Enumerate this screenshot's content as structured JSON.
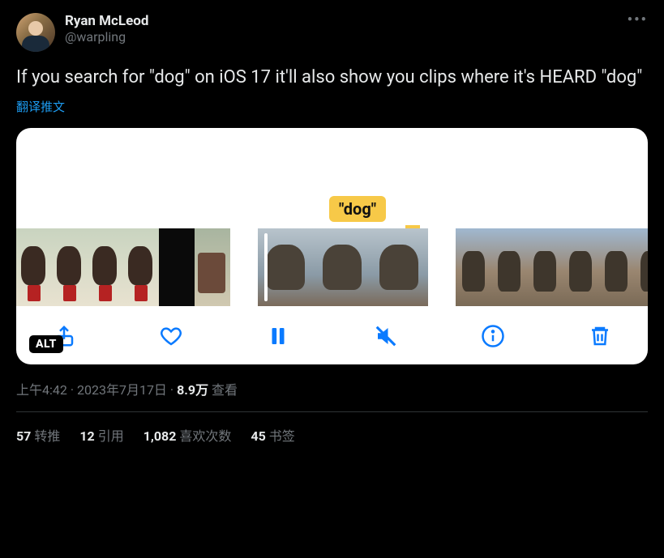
{
  "author": {
    "display_name": "Ryan McLeod",
    "handle": "@warpling"
  },
  "more_glyph": "•••",
  "body_text": "If you search for \"dog\" on iOS 17 it'll also show you clips where it's HEARD \"dog\"",
  "translate_label": "翻译推文",
  "media": {
    "tag_label": "\"dog\"",
    "alt_badge": "ALT"
  },
  "meta": {
    "time": "上午4:42",
    "dot1": " · ",
    "date": "2023年7月17日",
    "dot2": " · ",
    "views_num": "8.9万",
    "views_label": " 查看"
  },
  "stats": {
    "retweets_num": "57",
    "retweets_label": "转推",
    "quotes_num": "12",
    "quotes_label": "引用",
    "likes_num": "1,082",
    "likes_label": "喜欢次数",
    "bookmarks_num": "45",
    "bookmarks_label": "书签"
  }
}
